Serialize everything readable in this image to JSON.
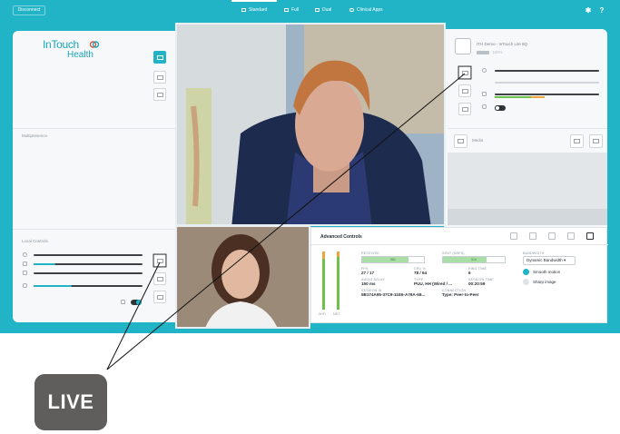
{
  "topbar": {
    "disconnect_label": "Disconnect",
    "layouts": [
      {
        "label": "Standard",
        "icon": "layout-standard-icon",
        "active": true
      },
      {
        "label": "Full",
        "icon": "layout-full-icon",
        "active": false
      },
      {
        "label": "Dual",
        "icon": "layout-dual-icon",
        "active": false
      },
      {
        "label": "Clinical Apps",
        "icon": "clinical-apps-icon",
        "active": false
      }
    ],
    "settings_icon": "gear-icon",
    "help_label": "?"
  },
  "left_panel": {
    "logo_text_1": "InTouch",
    "logo_text_2": "Health",
    "multipresence_label": "Multipresence",
    "local_controls_label": "Local Controls",
    "sliders": [
      {
        "name": "zoom",
        "level": 0.95
      },
      {
        "name": "brightness",
        "level": 0.2
      },
      {
        "name": "volume",
        "level": 0.98
      },
      {
        "name": "mic",
        "level": 0.35
      }
    ]
  },
  "right_panel": {
    "remote_name": "ITH Demo - InTouch Lite 8Q",
    "battery_label": "100%",
    "media_label": "Media"
  },
  "advanced": {
    "title": "Advanced Controls",
    "received_label": "RECEIVED",
    "received_value": "582",
    "received_level": 0.75,
    "sent_label": "SENT (KBPS)",
    "sent_value": "516",
    "sent_level": 0.7,
    "fps_label": "FPS",
    "fps_value": "27 / 17",
    "cpu_label": "CPU %",
    "cpu_value": "78 / 64",
    "ping_label": "PING TIME",
    "ping_value": "6",
    "audio_label": "AUDIO DELAY",
    "audio_value": "150 ms",
    "type_label": "TYPE",
    "type_value": "PUU, HH (Wired / ...",
    "session_time_label": "SESSION TIME",
    "session_time_value": "00:20:59",
    "session_id_label": "SESSION ID",
    "session_id_value": "5B174A95-37C9-11E6-A79A-68...",
    "connection_label": "CONNECTION",
    "connection_value": "Type: Peer-to-Peer",
    "wifi_label": "WIFI",
    "net_label": "NET",
    "bandwidth_label": "BANDWIDTH",
    "bandwidth_value": "Dynamic Bandwidth",
    "smooth_label": "Smooth motion",
    "sharp_label": "Sharp image"
  },
  "badge": {
    "label": "LIVE"
  },
  "colors": {
    "accent": "#21b3c6",
    "badge": "#5f5e5d",
    "signal_green": "#6cc24a",
    "signal_orange": "#f2a33a"
  }
}
